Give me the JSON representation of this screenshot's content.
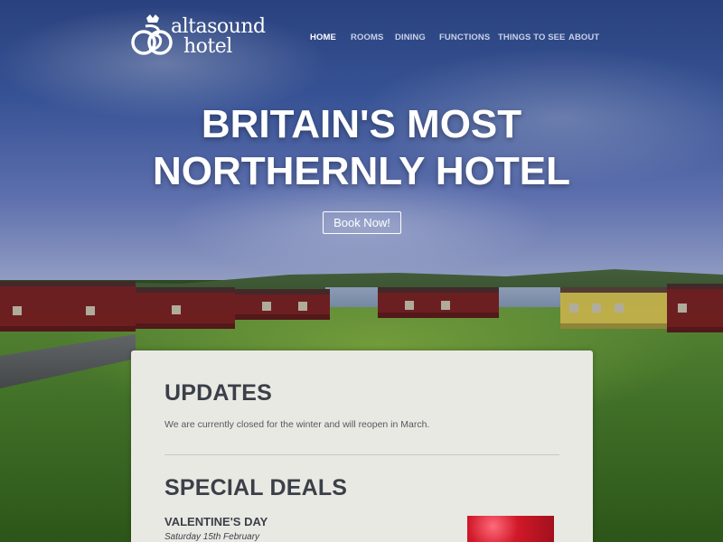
{
  "logo": {
    "line1": "altasound",
    "line2": "hotel"
  },
  "nav": {
    "items": [
      {
        "label": "HOME",
        "active": true
      },
      {
        "label": "ROOMS",
        "active": false
      },
      {
        "label": "DINING",
        "active": false
      },
      {
        "label": "FUNCTIONS",
        "active": false
      },
      {
        "label": "THINGS TO SEE",
        "active": false
      },
      {
        "label": "ABOUT",
        "active": false
      }
    ]
  },
  "hero": {
    "headline_line1": "BRITAIN'S MOST",
    "headline_line2": "NORTHERNLY HOTEL",
    "book_button": "Book Now!"
  },
  "updates": {
    "title": "UPDATES",
    "text": "We are currently closed for the winter and will reopen in March."
  },
  "deals": {
    "title": "SPECIAL DEALS",
    "items": [
      {
        "name": "VALENTINE'S DAY",
        "date": "Saturday 15th February"
      }
    ]
  },
  "colors": {
    "nav_active": "#ffffff",
    "nav_inactive": "#c9d1e6",
    "panel_bg": "#e9e9e3",
    "heading": "#3b3f48"
  }
}
